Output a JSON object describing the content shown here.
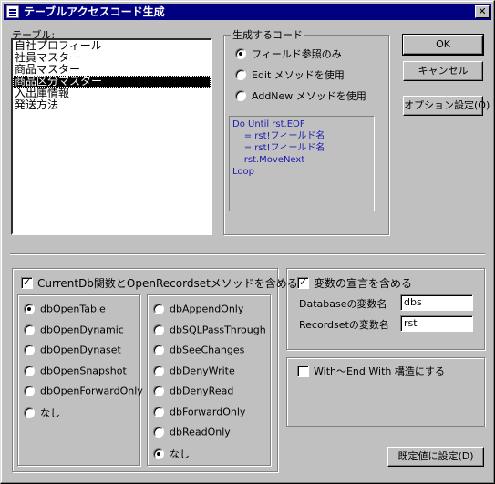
{
  "window": {
    "title": "テーブルアクセスコード生成",
    "close_glyph": "✕"
  },
  "table_list": {
    "label": "テーブル:",
    "items": [
      "自社プロフィール",
      "社員マスター",
      "商品マスター",
      "商品区分マスター",
      "入出庫情報",
      "発送方法"
    ],
    "selected_index": 3
  },
  "code_gen": {
    "title": "生成するコード",
    "options": [
      "フィールド参照のみ",
      "Edit メソッドを使用",
      "AddNew メソッドを使用"
    ],
    "selected_index": 0,
    "preview_lines": [
      "Do Until rst.EOF",
      "    = rst!フィールド名",
      "    = rst!フィールド名",
      "    rst.MoveNext",
      "Loop"
    ]
  },
  "buttons": {
    "ok": "OK",
    "cancel": "キャンセル",
    "options": "オプション設定(O)",
    "set_default": "既定値に設定(D)"
  },
  "open_group": {
    "check_label": "CurrentDb関数とOpenRecordsetメソッドを含める",
    "checked": true,
    "type_options": [
      "dbOpenTable",
      "dbOpenDynamic",
      "dbOpenDynaset",
      "dbOpenSnapshot",
      "dbOpenForwardOnly",
      "なし"
    ],
    "type_selected_index": 0,
    "option_flags": [
      "dbAppendOnly",
      "dbSQLPassThrough",
      "dbSeeChanges",
      "dbDenyWrite",
      "dbDenyRead",
      "dbForwardOnly",
      "dbReadOnly",
      "なし"
    ],
    "option_selected_index": 7
  },
  "var_group": {
    "check_label": "変数の宣言を含める",
    "checked": true,
    "db_label": "Databaseの変数名",
    "db_value": "dbs",
    "rs_label": "Recordsetの変数名",
    "rs_value": "rst"
  },
  "with_group": {
    "check_label": "With～End With 構造にする",
    "checked": false
  },
  "colors": {
    "title_bar": "#000080",
    "face": "#c0c0c0",
    "code_text": "#1c1cb0"
  }
}
